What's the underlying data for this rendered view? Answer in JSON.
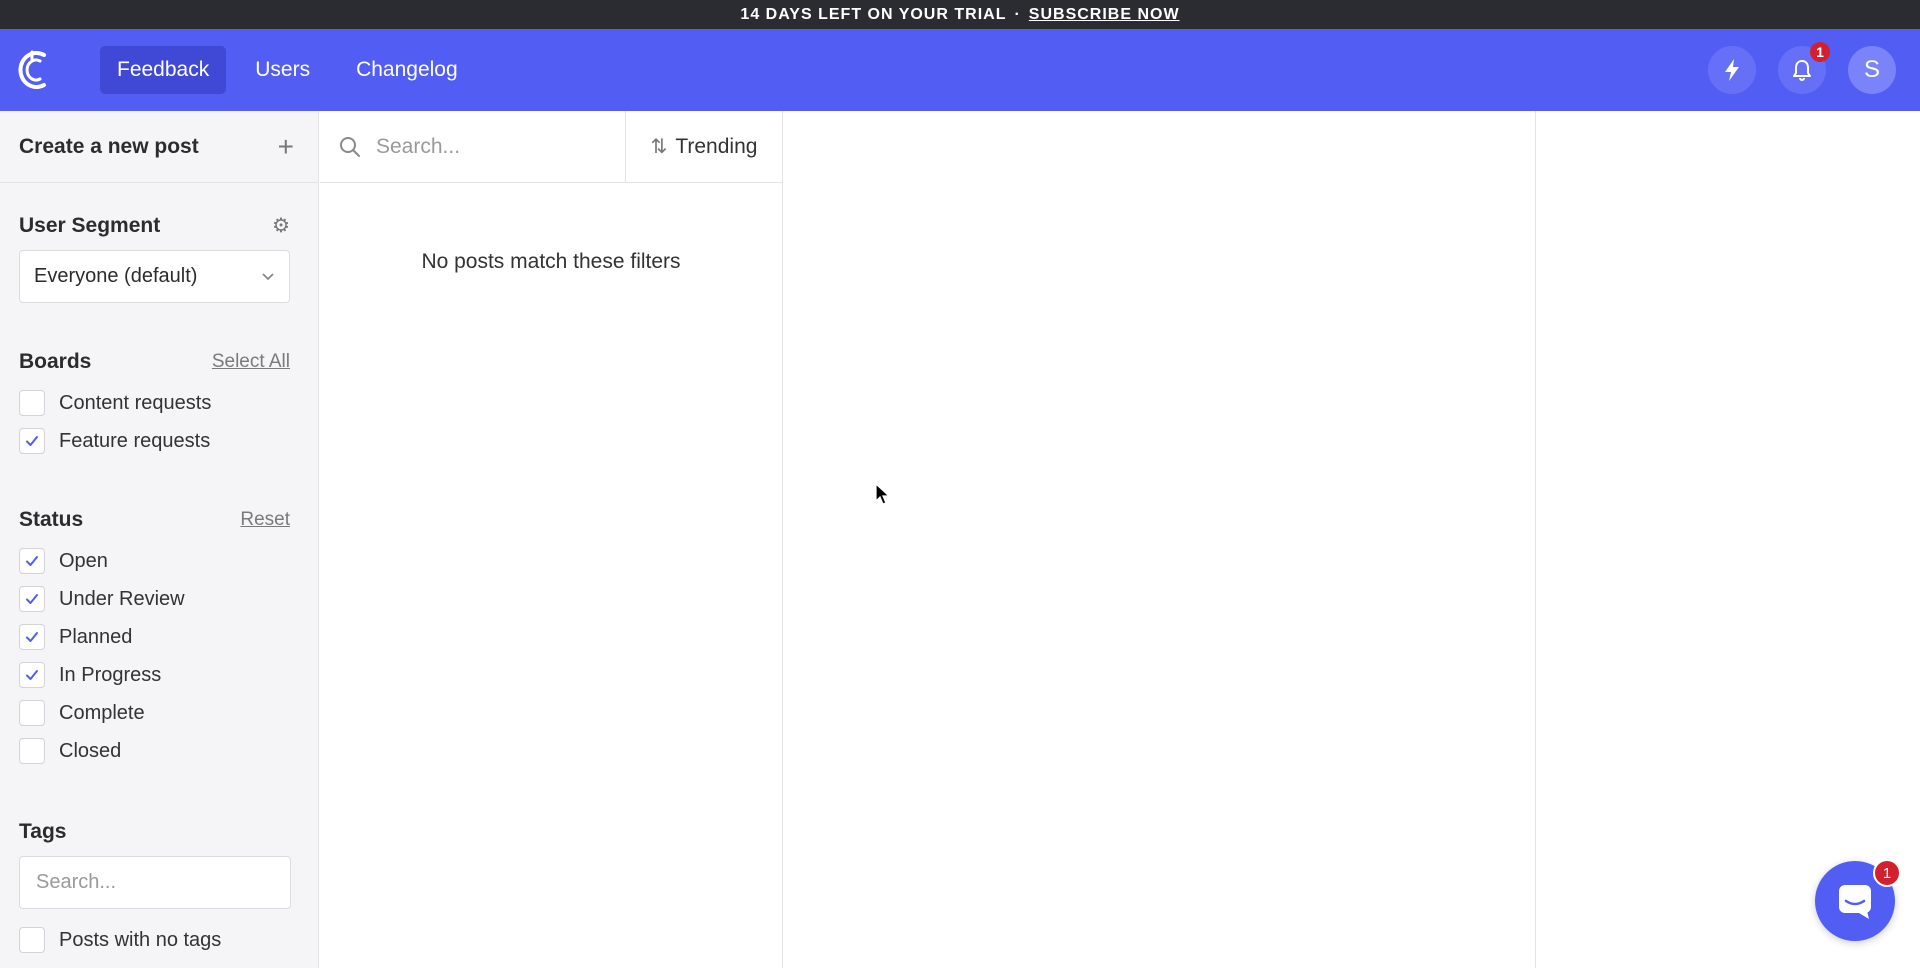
{
  "banner": {
    "trial_text": "14 DAYS LEFT ON YOUR TRIAL",
    "separator": "·",
    "subscribe_label": "SUBSCRIBE NOW"
  },
  "nav": {
    "tabs": [
      {
        "label": "Feedback",
        "active": true
      },
      {
        "label": "Users",
        "active": false
      },
      {
        "label": "Changelog",
        "active": false
      }
    ],
    "notification_count": "1",
    "avatar_initial": "S"
  },
  "sidebar": {
    "create_post_label": "Create a new post",
    "user_segment": {
      "heading": "User Segment",
      "selected": "Everyone (default)"
    },
    "boards": {
      "heading": "Boards",
      "action": "Select All",
      "items": [
        {
          "label": "Content requests",
          "checked": false
        },
        {
          "label": "Feature requests",
          "checked": true
        }
      ]
    },
    "status": {
      "heading": "Status",
      "action": "Reset",
      "items": [
        {
          "label": "Open",
          "checked": true
        },
        {
          "label": "Under Review",
          "checked": true
        },
        {
          "label": "Planned",
          "checked": true
        },
        {
          "label": "In Progress",
          "checked": true
        },
        {
          "label": "Complete",
          "checked": false
        },
        {
          "label": "Closed",
          "checked": false
        }
      ]
    },
    "tags": {
      "heading": "Tags",
      "search_placeholder": "Search...",
      "no_tags_label": "Posts with no tags",
      "no_tags_checked": false
    }
  },
  "postlist": {
    "search_placeholder": "Search...",
    "sort_label": "Trending",
    "empty_message": "No posts match these filters"
  },
  "chat": {
    "badge_count": "1"
  },
  "colors": {
    "brand": "#525df4",
    "banner_bg": "#2b2b32",
    "badge": "#d3202e",
    "check": "#525df4"
  }
}
